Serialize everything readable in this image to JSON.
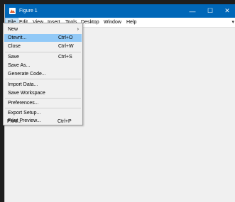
{
  "window": {
    "title": "Figure 1",
    "minimize_glyph": "—",
    "maximize_glyph": "☐",
    "close_glyph": "✕"
  },
  "menubar": {
    "items": [
      "File",
      "Edit",
      "View",
      "Insert",
      "Tools",
      "Desktop",
      "Window",
      "Help"
    ],
    "active": "File",
    "overflow_glyph": "▾"
  },
  "file_menu": {
    "items": [
      {
        "label": "New",
        "shortcut": "",
        "submenu": true
      },
      {
        "label": "Otevrit...",
        "shortcut": "Ctrl+O",
        "highlighted": true
      },
      {
        "label": "Close",
        "shortcut": "Ctrl+W"
      },
      {
        "label": "Save",
        "shortcut": "Ctrl+S"
      },
      {
        "label": "Save As...",
        "shortcut": ""
      },
      {
        "label": "Generate Code...",
        "shortcut": ""
      },
      {
        "label": "Import Data...",
        "shortcut": ""
      },
      {
        "label": "Save Workspace",
        "shortcut": ""
      },
      {
        "label": "Preferences...",
        "shortcut": ""
      },
      {
        "label": "Export Setup...",
        "shortcut": ""
      },
      {
        "label": "Print Preview...",
        "shortcut": ""
      },
      {
        "label": "Print...",
        "shortcut": "Ctrl+P"
      }
    ],
    "submenu_glyph": "›"
  },
  "colors": {
    "titlebar": "#0067b8",
    "highlight": "#91c9f7",
    "backdrop": "#1e1e1e"
  }
}
